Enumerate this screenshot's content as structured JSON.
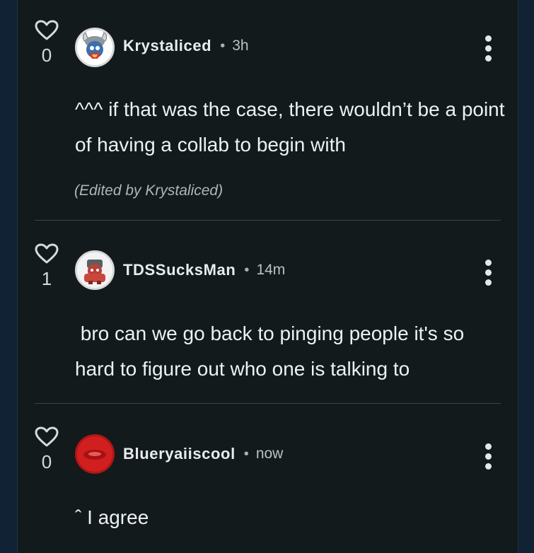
{
  "comments": [
    {
      "likes": "0",
      "author": "Krystaliced",
      "time": "3h",
      "body": "^^^ if that was the case, there wouldn’t be a point of having a collab to begin with",
      "edited": "(Edited by Krystaliced)"
    },
    {
      "likes": "1",
      "author": "TDSSucksMan",
      "time": "14m",
      "body": " bro can we go back to pinging people it's so hard to figure out who one is talking to"
    },
    {
      "likes": "0",
      "author": "Blueryaiiscool",
      "time": "now",
      "body": "ˆ I agree"
    }
  ],
  "separator": "•",
  "colors": {
    "panel": "#121a1c",
    "side": "#102233",
    "text": "#eef1f2",
    "muted": "#b9c1c5"
  },
  "icons": {
    "like": "heart-outline-icon",
    "menu": "vertical-dots-icon"
  }
}
